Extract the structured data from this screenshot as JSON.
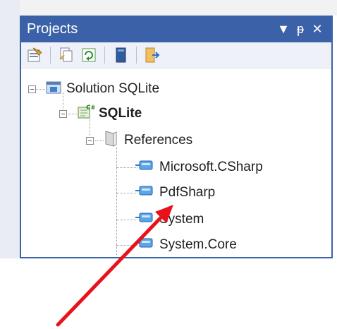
{
  "panel": {
    "title": "Projects",
    "controls": {
      "dropdown": "▼",
      "pin": "ᵽ",
      "close": "✕"
    }
  },
  "toolbar": {
    "icons": [
      "properties-icon",
      "show-all-files-icon",
      "refresh-icon",
      "view-code-icon",
      "open-folder-icon"
    ]
  },
  "tree": {
    "solution": "Solution SQLite",
    "project": "SQLite",
    "references": "References",
    "items": [
      "Microsoft.CSharp",
      "PdfSharp",
      "System",
      "System.Core"
    ]
  },
  "colors": {
    "panel_header": "#3b61a8",
    "annotation_arrow": "#e8121b"
  }
}
